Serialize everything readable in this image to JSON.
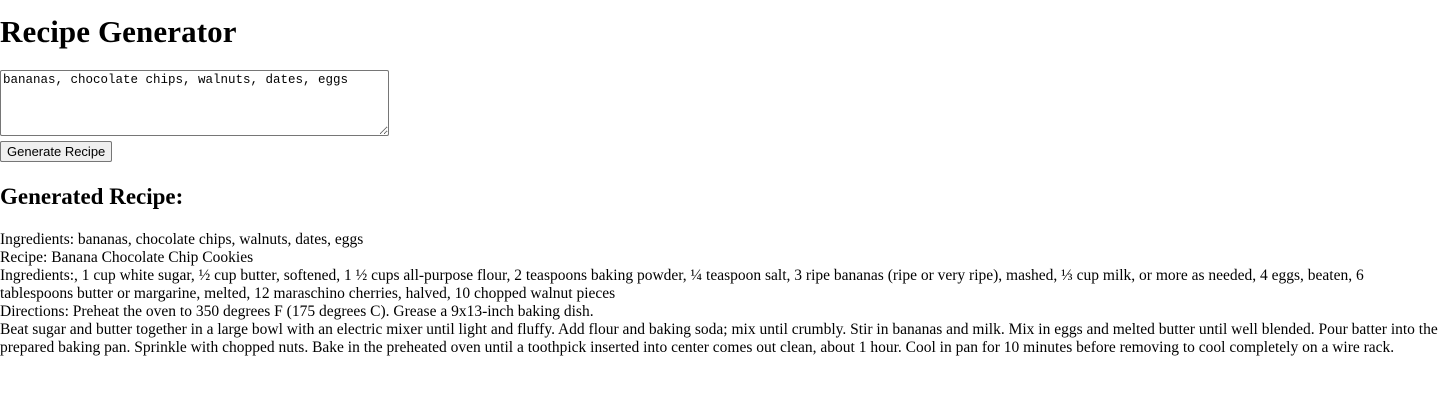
{
  "page": {
    "title": "Recipe Generator"
  },
  "form": {
    "ingredients_value": "bananas, chocolate chips, walnuts, dates, eggs",
    "generate_label": "Generate Recipe"
  },
  "result": {
    "heading": "Generated Recipe:",
    "ingredients_line": "Ingredients: bananas, chocolate chips, walnuts, dates, eggs",
    "recipe_line": "Recipe: Banana Chocolate Chip Cookies",
    "full_ingredients_line": "Ingredients:, 1 cup white sugar, ½ cup butter, softened, 1 ½ cups all-purpose flour, 2 teaspoons baking powder, ¼ teaspoon salt, 3 ripe bananas (ripe or very ripe), mashed, ⅓ cup milk, or more as needed, 4 eggs, beaten, 6 tablespoons butter or margarine, melted, 12 maraschino cherries, halved, 10 chopped walnut pieces",
    "directions_line": "Directions: Preheat the oven to 350 degrees F (175 degrees C). Grease a 9x13-inch baking dish.",
    "steps_line": "Beat sugar and butter together in a large bowl with an electric mixer until light and fluffy. Add flour and baking soda; mix until crumbly. Stir in bananas and milk. Mix in eggs and melted butter until well blended. Pour batter into the prepared baking pan. Sprinkle with chopped nuts. Bake in the preheated oven until a toothpick inserted into center comes out clean, about 1 hour. Cool in pan for 10 minutes before removing to cool completely on a wire rack."
  }
}
